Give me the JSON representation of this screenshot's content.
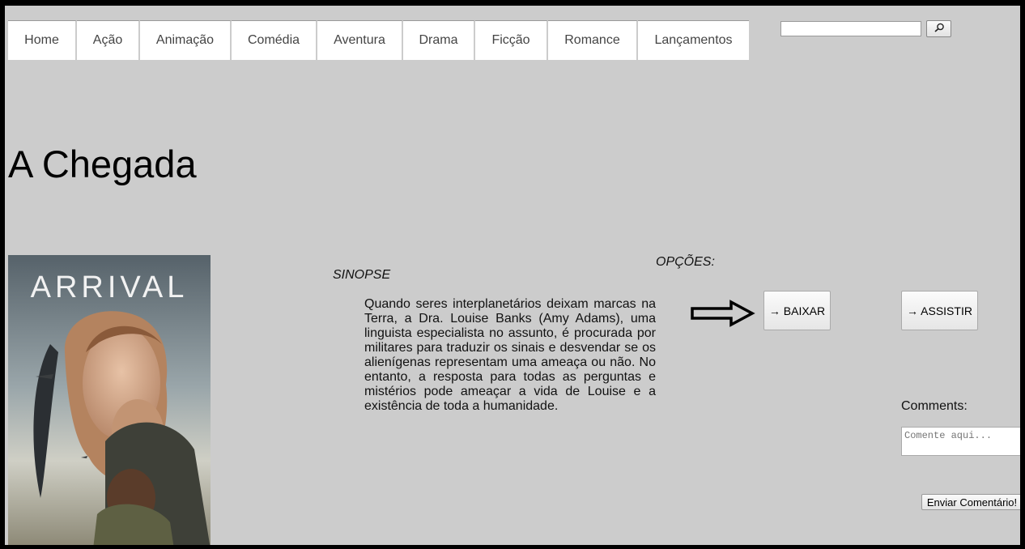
{
  "nav": {
    "items": [
      {
        "label": "Home"
      },
      {
        "label": "Ação"
      },
      {
        "label": "Animação"
      },
      {
        "label": "Comédia"
      },
      {
        "label": "Aventura"
      },
      {
        "label": "Drama"
      },
      {
        "label": "Ficção"
      },
      {
        "label": "Romance"
      },
      {
        "label": "Lançamentos"
      }
    ]
  },
  "search": {
    "value": "",
    "icon": "search-icon"
  },
  "movie": {
    "title": "A Chegada",
    "poster_text": "ARRIVAL"
  },
  "sinopse": {
    "label": "SINOPSE",
    "text": "Quando seres interplanetários deixam marcas na Terra, a Dra. Louise Banks (Amy Adams), uma linguista especialista no assunto, é procurada por militares para traduzir os sinais e desvendar se os alienígenas representam uma ameaça ou não. No entanto, a resposta para todas as perguntas e mistérios pode ameaçar a vida de Louise e a existência de toda a humanidade."
  },
  "options": {
    "label": "OPÇÕES:",
    "download_label": "→ BAIXAR",
    "watch_label": "→ ASSISTIR",
    "arrow_icon": "arrow-right-outline-icon"
  },
  "comments": {
    "label": "Comments:",
    "placeholder": "Comente aqui...",
    "submit_label": "Enviar Comentário!"
  },
  "colors": {
    "page_bg": "#cccccc",
    "frame": "#000000",
    "nav_bg": "#ffffff"
  }
}
